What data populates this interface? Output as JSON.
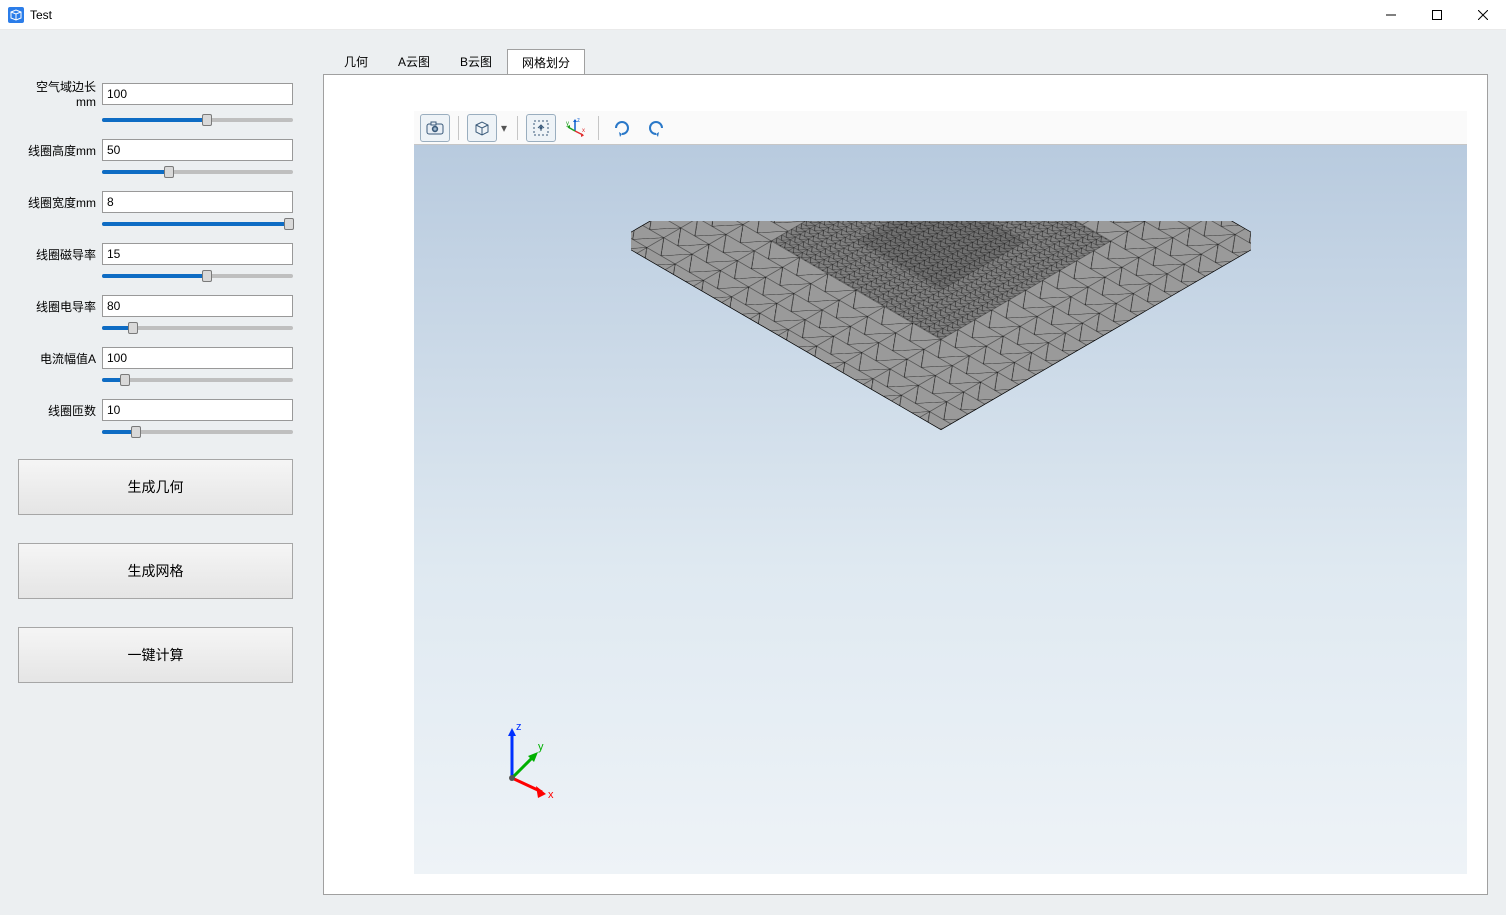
{
  "window": {
    "title": "Test"
  },
  "params": [
    {
      "label": "空气域边长mm",
      "value": "100",
      "fill_pct": 55
    },
    {
      "label": "线圈高度mm",
      "value": "50",
      "fill_pct": 35
    },
    {
      "label": "线圈宽度mm",
      "value": "8",
      "fill_pct": 98
    },
    {
      "label": "线圈磁导率",
      "value": "15",
      "fill_pct": 55
    },
    {
      "label": "线圈电导率",
      "value": "80",
      "fill_pct": 16
    },
    {
      "label": "电流幅值A",
      "value": "100",
      "fill_pct": 12
    },
    {
      "label": "线圈匝数",
      "value": "10",
      "fill_pct": 18
    }
  ],
  "buttons": {
    "gen_geom": "生成几何",
    "gen_mesh": "生成网格",
    "compute": "一键计算"
  },
  "tabs": {
    "items": [
      "几何",
      "A云图",
      "B云图",
      "网格划分"
    ],
    "active_index": 3
  },
  "toolbar_icons": {
    "camera": "camera-icon",
    "cube": "cube-icon",
    "fit": "fit-view-icon",
    "axes": "axes-icon",
    "rotate_cw": "rotate-cw-icon",
    "rotate_ccw": "rotate-ccw-icon"
  },
  "axis_labels": {
    "x": "x",
    "y": "y",
    "z": "z"
  }
}
